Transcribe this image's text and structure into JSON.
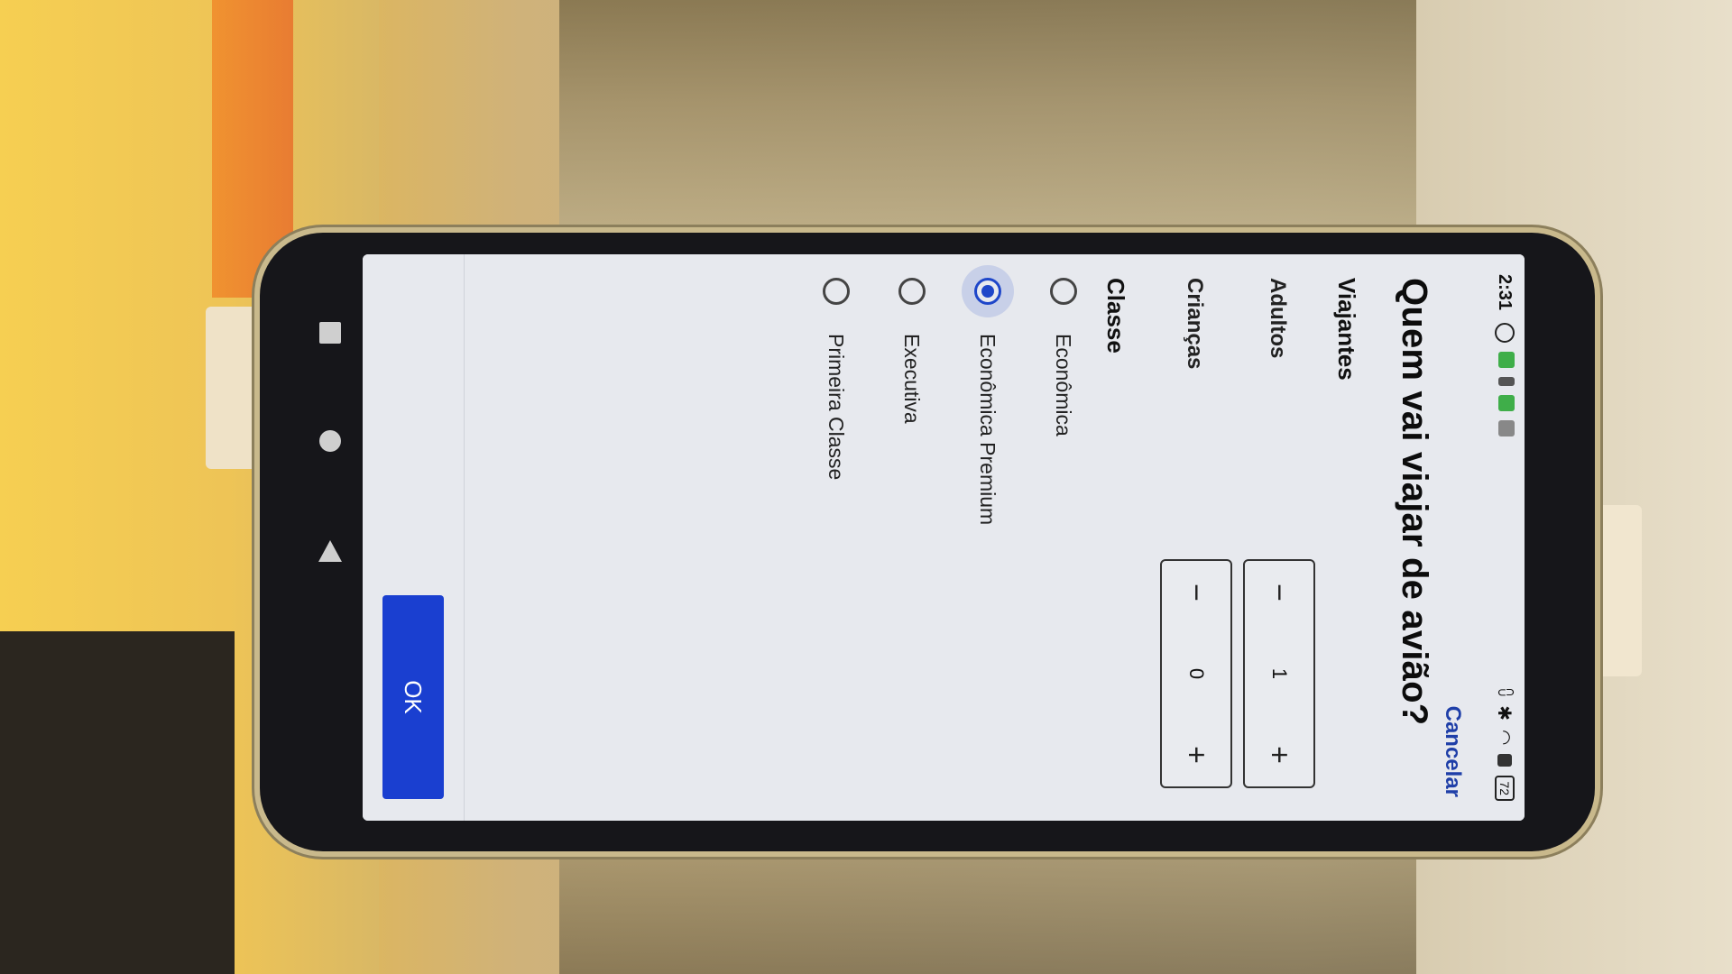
{
  "status": {
    "time": "2:31",
    "battery": "72"
  },
  "dialog": {
    "cancel_label": "Cancelar",
    "title": "Quem vai viajar de avião?",
    "travelers_heading": "Viajantes",
    "adults": {
      "label": "Adultos",
      "value": "1",
      "minus": "−",
      "plus": "+"
    },
    "children": {
      "label": "Crianças",
      "value": "0",
      "minus": "−",
      "plus": "+"
    },
    "class_heading": "Classe",
    "class_options": [
      {
        "label": "Econômica",
        "selected": false
      },
      {
        "label": "Econômica Premium",
        "selected": true
      },
      {
        "label": "Executiva",
        "selected": false
      },
      {
        "label": "Primeira Classe",
        "selected": false
      }
    ],
    "ok_label": "OK"
  },
  "colors": {
    "accent": "#1a3fd0",
    "link": "#1f3fa8",
    "screen_bg": "#e7e9ee"
  }
}
